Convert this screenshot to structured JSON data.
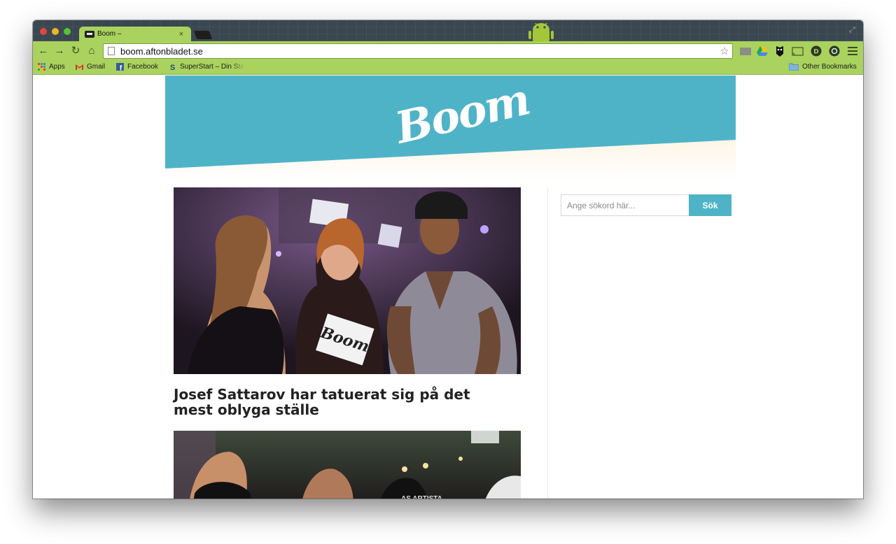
{
  "browser": {
    "tab": {
      "title": "Boom –",
      "close": "×"
    },
    "url": "boom.aftonbladet.se",
    "bookmarks": [
      {
        "label": "Apps"
      },
      {
        "label": "Gmail"
      },
      {
        "label": "Facebook"
      },
      {
        "label": "SuperStart – Din Sta"
      }
    ],
    "other_bookmarks": "Other Bookmarks"
  },
  "site": {
    "logo": "Boom",
    "colors": {
      "banner": "#4fb3c8",
      "button": "#4fb3c8"
    }
  },
  "articles": [
    {
      "title": "Josef Sattarov har tatuerat sig på det mest oblyga ställe"
    },
    {
      "title": ""
    }
  ],
  "search": {
    "placeholder": "Ange sökord här...",
    "button_label": "Sök"
  }
}
